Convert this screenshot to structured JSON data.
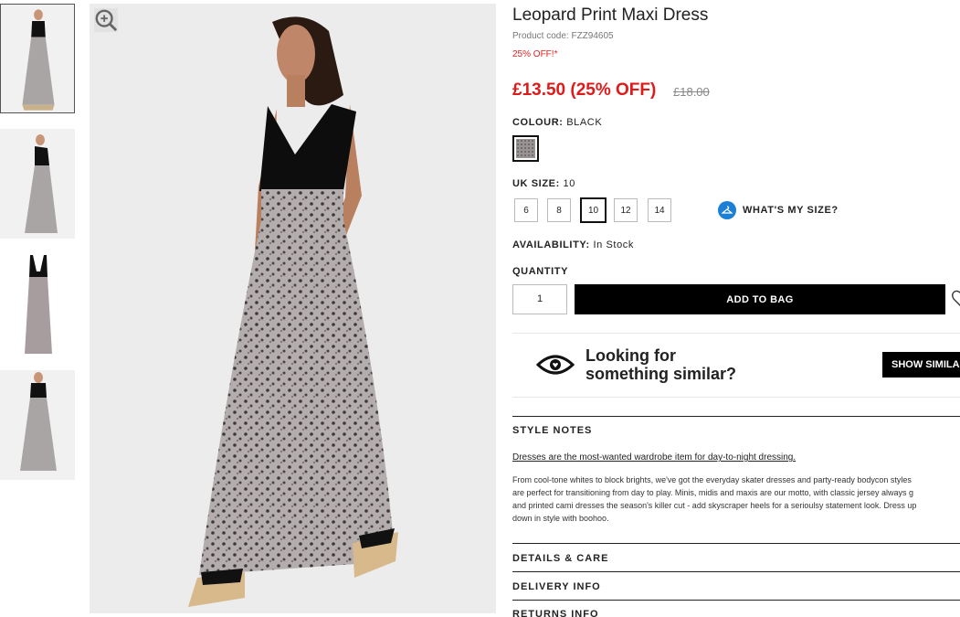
{
  "product": {
    "title": "Leopard Print Maxi Dress",
    "code": "Product code: FZZ94605",
    "promo": "25% OFF!*",
    "price": "£13.50 (25% OFF)",
    "was_price": "£18.00"
  },
  "colour": {
    "label": "COLOUR:",
    "value": "BLACK"
  },
  "size": {
    "label": "UK SIZE:",
    "value": "10",
    "options": [
      "6",
      "8",
      "10",
      "12",
      "14"
    ],
    "selected": "10",
    "help": "WHAT'S MY SIZE?"
  },
  "availability": {
    "label": "AVAILABILITY:",
    "value": "In Stock"
  },
  "quantity": {
    "label": "QUANTITY",
    "value": "1"
  },
  "add_to_bag": "ADD TO BAG",
  "similar": {
    "line1": "Looking for",
    "line2": "something similar?",
    "button": "SHOW SIMILAR"
  },
  "style_notes": {
    "heading": "STYLE NOTES",
    "subheading": "Dresses are the most-wanted wardrobe item for day-to-night dressing.",
    "body_lines": [
      "From cool-tone whites to block brights, we've got the everyday skater dresses and party-ready bodycon styles",
      "are perfect for transitioning from day to play. Minis, midis and maxis are our motto, with classic jersey always g",
      "and printed cami dresses the season's killer cut - add skyscraper heels for a serioulsy statement look. Dress up",
      "down in style with boohoo."
    ]
  },
  "sections": {
    "details": "DETAILS & CARE",
    "delivery": "DELIVERY INFO",
    "returns": "RETURNS INFO"
  },
  "colors": {
    "price_red": "#e01a1a",
    "accent_blue": "#1b7fd6",
    "black": "#000000"
  }
}
